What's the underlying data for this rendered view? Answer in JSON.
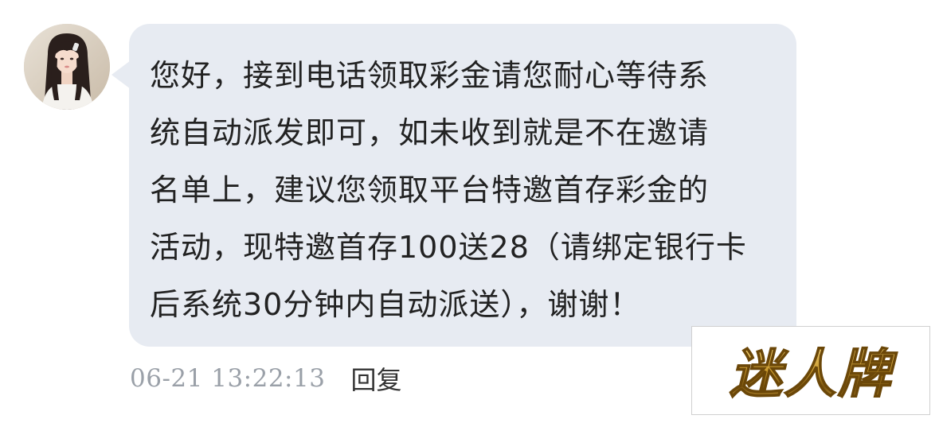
{
  "message": {
    "lines": [
      "您好，接到电话领取彩金请您耐心等待系",
      "统自动派发即可，如未收到就是不在邀请",
      "名单上，建议您领取平台特邀首存彩金的",
      "活动，现特邀首存100送28（请绑定银行卡",
      "后系统30分钟内自动派送），谢谢！"
    ],
    "timestamp": "06-21 13:22:13",
    "reply_label": "回复"
  },
  "watermark": {
    "text": "迷人牌"
  },
  "colors": {
    "bubble_bg": "#e7ebf2",
    "text": "#222222",
    "timestamp": "#9aa0a8",
    "watermark_gold": "#c99a2e"
  },
  "icons": {
    "avatar": "user-avatar-photo"
  }
}
